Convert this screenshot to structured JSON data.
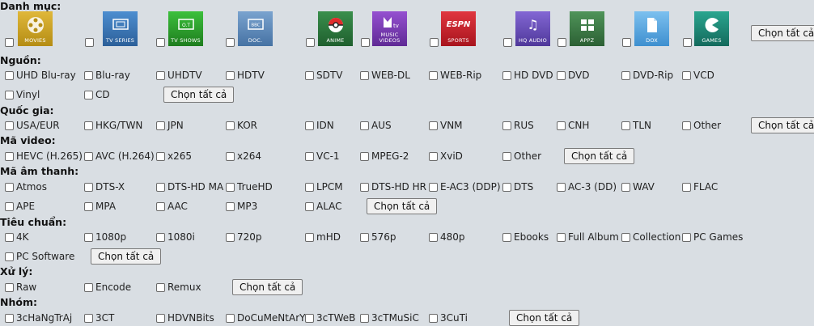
{
  "sections": {
    "category": "Danh mục:",
    "source": "Nguồn:",
    "country": "Quốc gia:",
    "video_codec": "Mã video:",
    "audio_codec": "Mã âm thanh:",
    "standard": "Tiêu chuẩn:",
    "processing": "Xử lý:",
    "group": "Nhóm:"
  },
  "select_all_label": "Chọn tất cả",
  "categories": [
    {
      "label": "MOVIES",
      "icon": "film-reel-icon",
      "color": "#c9a227"
    },
    {
      "label": "TV SERIES",
      "icon": "tv-series-icon",
      "color": "#3f79b5"
    },
    {
      "label": "TV SHOWS",
      "icon": "tv-shows-icon",
      "color": "#2fa12f"
    },
    {
      "label": "DOC.",
      "icon": "bbc-doc-icon",
      "color": "#5b86b5"
    },
    {
      "label": "ANIME",
      "icon": "pokeball-icon",
      "color": "#2d7a3e"
    },
    {
      "label": "MUSIC VIDEOS",
      "icon": "mtv-icon",
      "color": "#7a3fb0"
    },
    {
      "label": "SPORTS",
      "icon": "espn-icon",
      "color": "#c8232c"
    },
    {
      "label": "HQ AUDIO",
      "icon": "music-note-icon",
      "color": "#6b4fb8"
    },
    {
      "label": "APPZ",
      "icon": "windows-icon",
      "color": "#3e7a48"
    },
    {
      "label": "DOX",
      "icon": "document-icon",
      "color": "#5aa7e0"
    },
    {
      "label": "GAMES",
      "icon": "pacman-icon",
      "color": "#1f8a7a"
    }
  ],
  "source_options": [
    "UHD Blu-ray",
    "Blu-ray",
    "UHDTV",
    "HDTV",
    "SDTV",
    "WEB-DL",
    "WEB-Rip",
    "HD DVD",
    "DVD",
    "DVD-Rip",
    "VCD",
    "Vinyl",
    "CD"
  ],
  "country_options": [
    "USA/EUR",
    "HKG/TWN",
    "JPN",
    "KOR",
    "IDN",
    "AUS",
    "VNM",
    "RUS",
    "CNH",
    "TLN",
    "Other"
  ],
  "video_options": [
    "HEVC (H.265)",
    "AVC (H.264)",
    "x265",
    "x264",
    "VC-1",
    "MPEG-2",
    "XviD",
    "Other"
  ],
  "audio_options": [
    "Atmos",
    "DTS-X",
    "DTS-HD MA",
    "TrueHD",
    "LPCM",
    "DTS-HD HR",
    "E-AC3 (DDP)",
    "DTS",
    "AC-3 (DD)",
    "WAV",
    "FLAC",
    "APE",
    "MPA",
    "AAC",
    "MP3",
    "ALAC"
  ],
  "standard_options": [
    "4K",
    "1080p",
    "1080i",
    "720p",
    "mHD",
    "576p",
    "480p",
    "Ebooks",
    "Full Album",
    "Collection",
    "PC Games",
    "PC Software"
  ],
  "processing_options": [
    "Raw",
    "Encode",
    "Remux"
  ],
  "group_options": [
    "3cHaNgTrAj",
    "3CT",
    "HDVNBits",
    "DoCuMeNtArY",
    "3cTWeB",
    "3cTMuSiC",
    "3CuTi"
  ]
}
